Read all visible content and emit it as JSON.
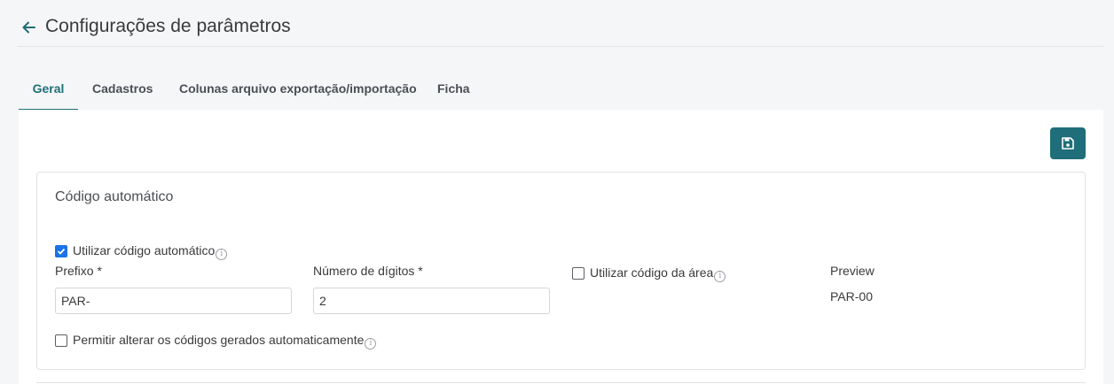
{
  "header": {
    "title": "Configurações de parâmetros"
  },
  "tabs": [
    {
      "label": "Geral",
      "active": true
    },
    {
      "label": "Cadastros",
      "active": false
    },
    {
      "label": "Colunas arquivo exportação/importação",
      "active": false
    },
    {
      "label": "Ficha",
      "active": false
    }
  ],
  "card": {
    "title": "Código automático",
    "use_auto_code": {
      "label": "Utilizar código automático",
      "checked": true,
      "info_icon": "info-icon"
    },
    "prefix": {
      "label": "Prefixo *",
      "value": "PAR-"
    },
    "digits": {
      "label": "Número de dígitos *",
      "value": "2"
    },
    "use_area_code": {
      "label": "Utilizar código da área",
      "checked": false,
      "info_icon": "info-icon"
    },
    "preview": {
      "label": "Preview",
      "value": "PAR-00"
    },
    "allow_edit": {
      "label": "Permitir alterar os códigos gerados automaticamente",
      "checked": false,
      "info_icon": "info-icon"
    }
  },
  "toolbar": {
    "save_icon": "floppy-disk-icon"
  },
  "colors": {
    "accent": "#1e6f77",
    "save_button": "#1f6e79",
    "checkbox_checked": "#1a73e8"
  }
}
